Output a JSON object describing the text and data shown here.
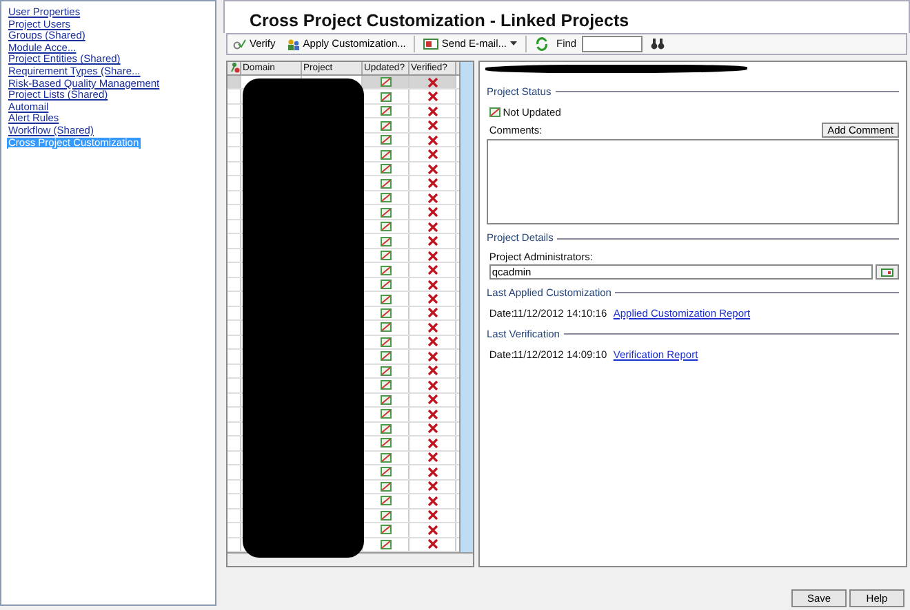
{
  "sidebar": {
    "items": [
      {
        "label": "User Properties",
        "selected": false
      },
      {
        "label": "Project Users",
        "selected": false
      },
      {
        "label": "Groups (Shared)",
        "selected": false
      },
      {
        "label": "Module Acce...",
        "selected": false
      },
      {
        "label": "Project Entities (Shared)",
        "selected": false
      },
      {
        "label": "Requirement Types (Share...",
        "selected": false
      },
      {
        "label": "Risk-Based Quality Management",
        "selected": false
      },
      {
        "label": "Project Lists (Shared)",
        "selected": false
      },
      {
        "label": "Automail",
        "selected": false
      },
      {
        "label": "Alert Rules",
        "selected": false
      },
      {
        "label": "Workflow (Shared)",
        "selected": false
      },
      {
        "label": "Cross Project Customization",
        "selected": true
      }
    ]
  },
  "title": "Cross Project Customization - Linked Projects",
  "toolbar": {
    "verify": "Verify",
    "apply": "Apply Customization...",
    "email": "Send E-mail...",
    "find_label": "Find"
  },
  "grid": {
    "columns": [
      "Domain",
      "Project",
      "Updated?",
      "Verified?"
    ],
    "rows": [
      {
        "selected": true
      },
      {
        "selected": false
      },
      {
        "selected": false
      },
      {
        "selected": false
      },
      {
        "selected": false
      },
      {
        "selected": false
      },
      {
        "selected": false
      },
      {
        "selected": false
      },
      {
        "selected": false
      },
      {
        "selected": false
      },
      {
        "selected": false
      },
      {
        "selected": false
      },
      {
        "selected": false
      },
      {
        "selected": false
      },
      {
        "selected": false
      },
      {
        "selected": false
      },
      {
        "selected": false
      },
      {
        "selected": false
      },
      {
        "selected": false
      },
      {
        "selected": false
      },
      {
        "selected": false
      },
      {
        "selected": false
      },
      {
        "selected": false
      },
      {
        "selected": false
      },
      {
        "selected": false
      },
      {
        "selected": false
      },
      {
        "selected": false
      },
      {
        "selected": false
      },
      {
        "selected": false
      },
      {
        "selected": false
      },
      {
        "selected": false
      },
      {
        "selected": false
      },
      {
        "selected": false
      }
    ]
  },
  "details": {
    "status_heading": "Project Status",
    "status": "Not Updated",
    "comments_label": "Comments:",
    "add_comment": "Add Comment",
    "details_heading": "Project Details",
    "admins_label": "Project Administrators:",
    "admins_value": "qcadmin",
    "customization_heading": "Last Applied Customization",
    "customization_date_label": "Date:",
    "customization_date": "11/12/2012 14:10:16",
    "customization_link": "Applied Customization Report",
    "verification_heading": "Last Verification",
    "verification_date_label": "Date:",
    "verification_date": "11/12/2012 14:09:10",
    "verification_link": "Verification Report"
  },
  "buttons": [
    "Save",
    "Help"
  ]
}
